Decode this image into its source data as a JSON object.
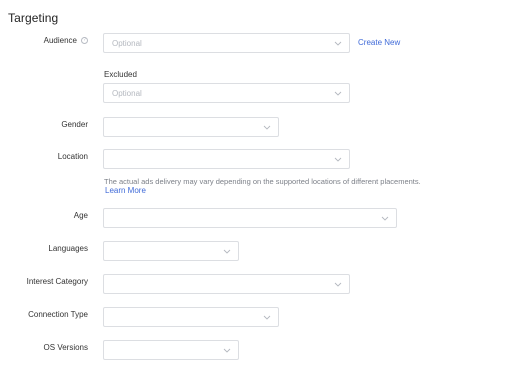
{
  "section": {
    "title": "Targeting"
  },
  "audience": {
    "label": "Audience",
    "placeholder": "Optional",
    "create_new": "Create New",
    "excluded_label": "Excluded",
    "excluded_placeholder": "Optional"
  },
  "gender": {
    "label": "Gender",
    "value": ""
  },
  "location": {
    "label": "Location",
    "value": "",
    "hint": "The actual ads delivery may vary depending on the supported locations of different placements.",
    "learn_more": "Learn More"
  },
  "age": {
    "label": "Age",
    "value": ""
  },
  "languages": {
    "label": "Languages",
    "value": ""
  },
  "interest_category": {
    "label": "Interest Category",
    "value": ""
  },
  "connection_type": {
    "label": "Connection Type",
    "value": ""
  },
  "os_versions": {
    "label": "OS Versions",
    "value": ""
  },
  "icons": {
    "help": "question-circle-icon",
    "dropdown": "chevron-down-icon"
  },
  "colors": {
    "link": "#3f6ad8",
    "border": "#dcdee2",
    "placeholder": "#b4b8bf"
  }
}
